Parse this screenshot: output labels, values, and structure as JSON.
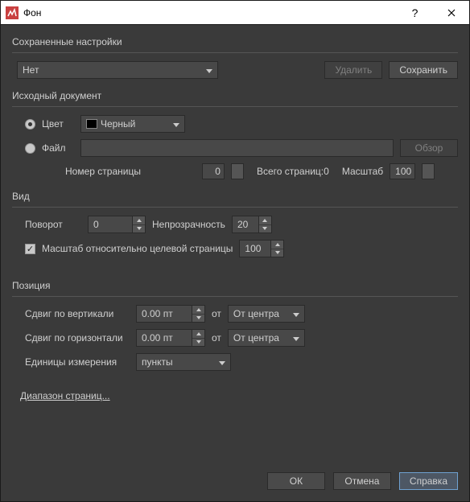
{
  "window": {
    "title": "Фон"
  },
  "presets": {
    "heading": "Сохраненные настройки",
    "selected": "Нет",
    "delete": "Удалить",
    "save": "Сохранить"
  },
  "source": {
    "heading": "Исходный документ",
    "color_label": "Цвет",
    "color_value": "Черный",
    "file_label": "Файл",
    "file_value": "",
    "browse": "Обзор",
    "page_number_label": "Номер страницы",
    "page_number": "0",
    "total_pages_label": "Всего страниц:",
    "total_pages": "0",
    "scale_label": "Масштаб",
    "scale_value": "100"
  },
  "appearance": {
    "heading": "Вид",
    "rotation_label": "Поворот",
    "rotation_value": "0",
    "opacity_label": "Непрозрачность",
    "opacity_value": "20",
    "scale_relative_label": "Масштаб относительно целевой страницы",
    "scale_relative_value": "100",
    "scale_relative_checked": true
  },
  "position": {
    "heading": "Позиция",
    "voffset_label": "Сдвиг по вертикали",
    "voffset_value": "0.00 пт",
    "hoffset_label": "Сдвиг по горизонтали",
    "hoffset_value": "0.00 пт",
    "from_label": "от",
    "vfrom": "От центра",
    "hfrom": "От центра",
    "units_label": "Единицы измерения",
    "units_value": "пункты"
  },
  "page_range_link": "Диапазон страниц...",
  "buttons": {
    "ok": "ОК",
    "cancel": "Отмена",
    "help": "Справка"
  }
}
